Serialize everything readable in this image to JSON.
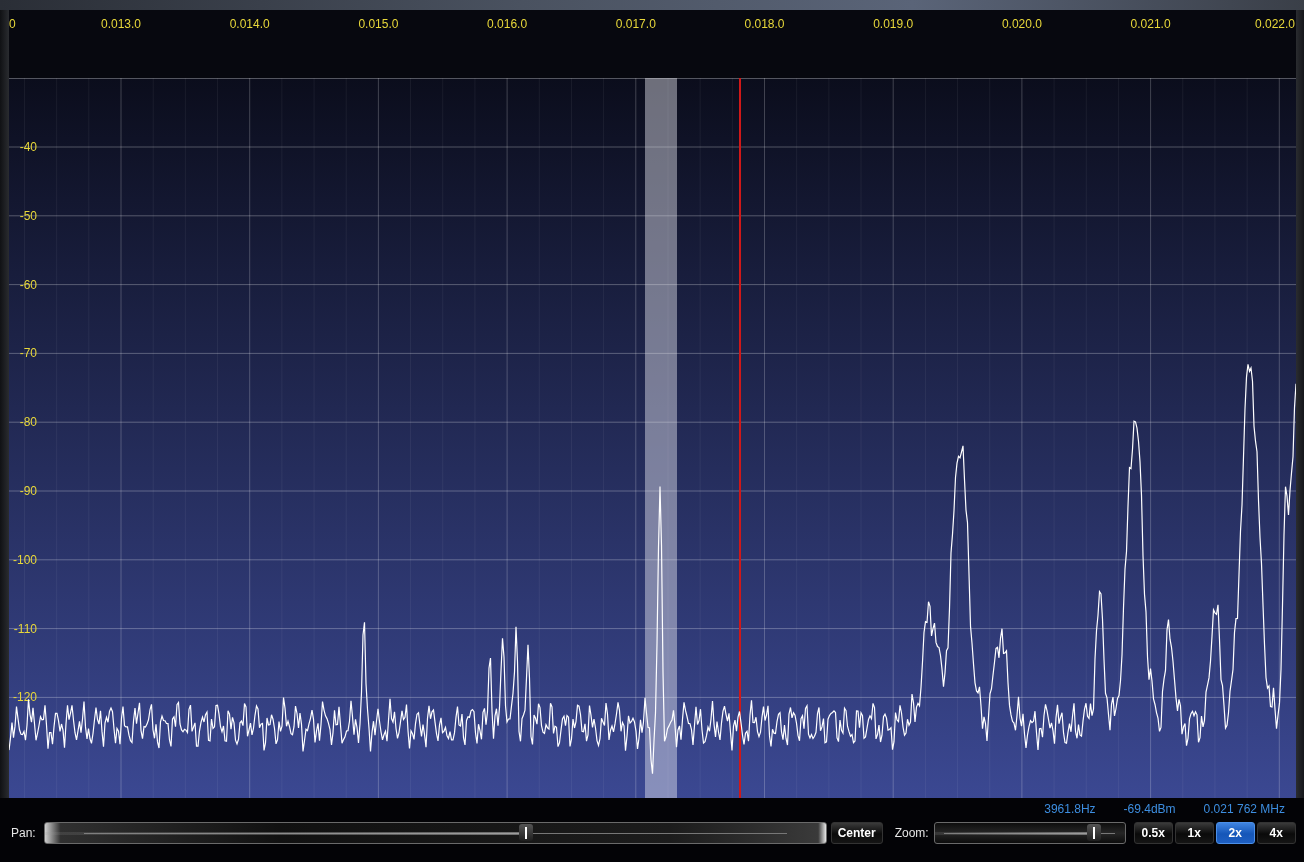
{
  "frequency_axis": {
    "ticks": [
      "0",
      "0.013.0",
      "0.014.0",
      "0.015.0",
      "0.016.0",
      "0.017.0",
      "0.018.0",
      "0.019.0",
      "0.020.0",
      "0.021.0",
      "0.022.0"
    ]
  },
  "level_axis": {
    "ticks": [
      "-40",
      "-50",
      "-60",
      "-70",
      "-80",
      "-90",
      "-100",
      "-110",
      "-120"
    ]
  },
  "readouts": [
    "3961.8Hz",
    "-69.4dBm",
    "0.021 762 MHz"
  ],
  "pan": {
    "label": "Pan:",
    "level": 0.616
  },
  "center_button": "Center",
  "zoom": {
    "label": "Zoom:",
    "level": 0.84,
    "presets": [
      {
        "label": "0.5x",
        "selected": false
      },
      {
        "label": "1x",
        "selected": false
      },
      {
        "label": "2x",
        "selected": true
      },
      {
        "label": "4x",
        "selected": false
      }
    ]
  }
}
